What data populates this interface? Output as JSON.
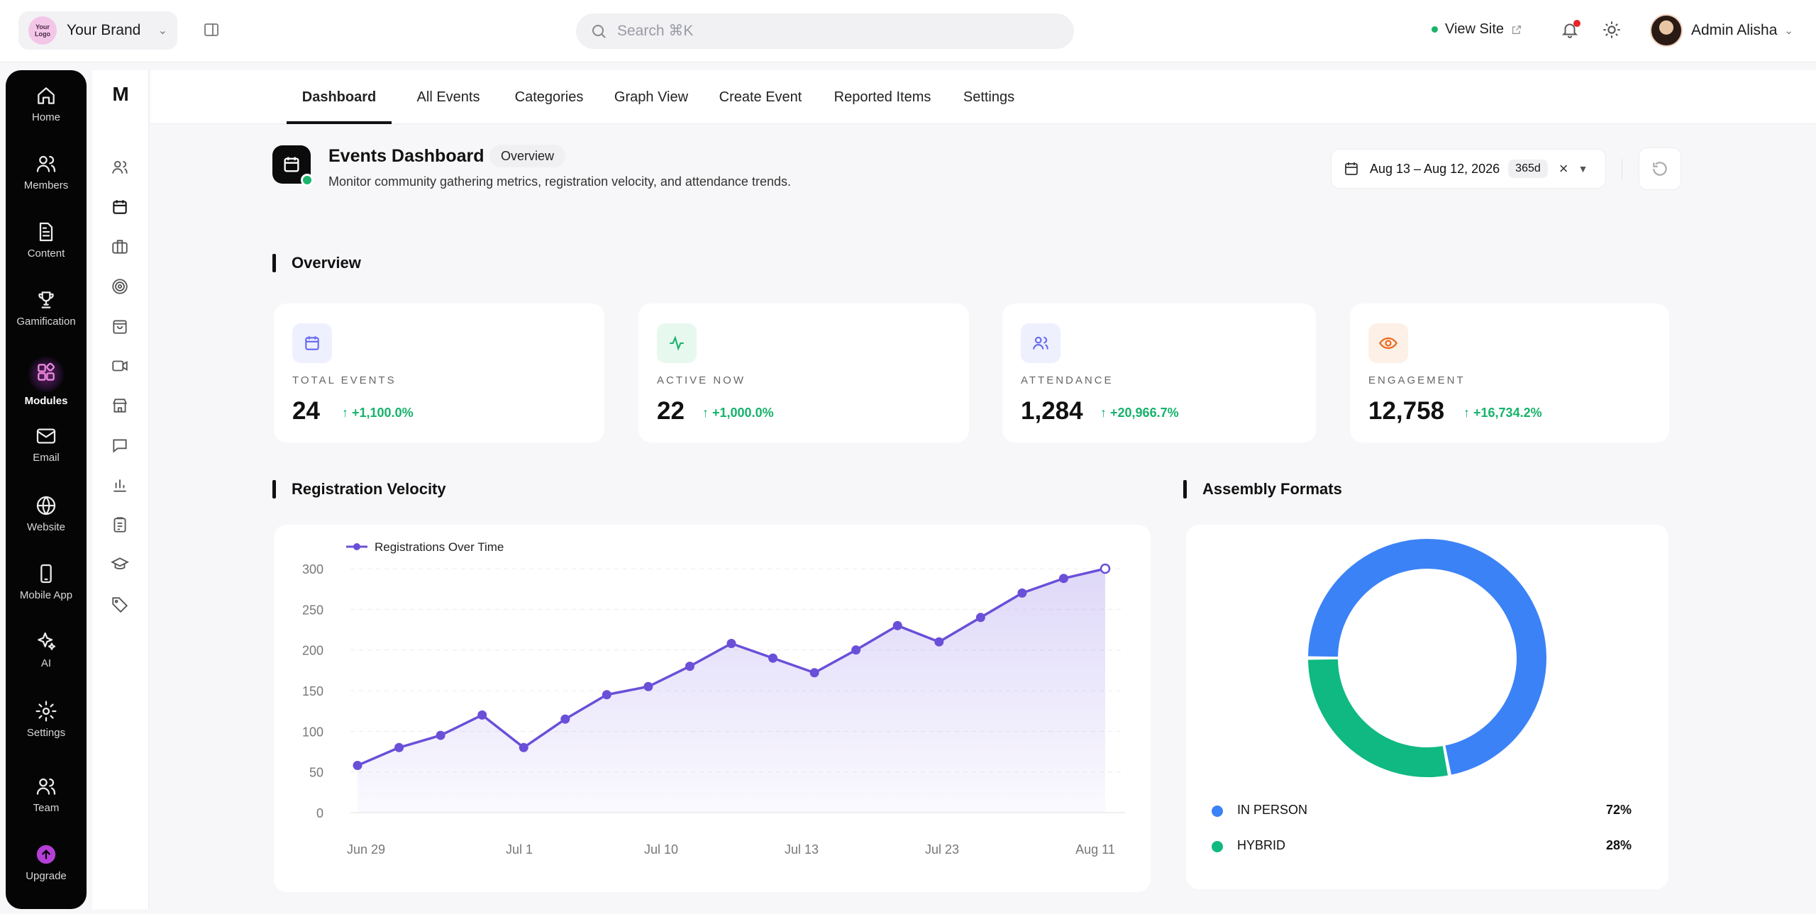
{
  "brand": {
    "logo_text": "Your Logo",
    "name": "Your Brand"
  },
  "search": {
    "placeholder": "Search ⌘K"
  },
  "topbar": {
    "view_site": "View Site",
    "user_name": "Admin Alisha"
  },
  "rail": {
    "items": [
      {
        "label": "Home",
        "icon": "home-icon"
      },
      {
        "label": "Members",
        "icon": "users-icon"
      },
      {
        "label": "Content",
        "icon": "document-icon"
      },
      {
        "label": "Gamification",
        "icon": "trophy-icon"
      },
      {
        "label": "Modules",
        "icon": "modules-icon",
        "active": true
      },
      {
        "label": "Email",
        "icon": "mail-icon"
      },
      {
        "label": "Website",
        "icon": "globe-icon"
      },
      {
        "label": "Mobile App",
        "icon": "phone-icon"
      },
      {
        "label": "AI",
        "icon": "sparkles-icon"
      },
      {
        "label": "Settings",
        "icon": "gear-icon"
      },
      {
        "label": "Team",
        "icon": "team-icon"
      },
      {
        "label": "Upgrade",
        "icon": "upgrade-icon"
      }
    ]
  },
  "subrail": {
    "logo": "M"
  },
  "tabs": [
    "Dashboard",
    "All Events",
    "Categories",
    "Graph View",
    "Create Event",
    "Reported Items",
    "Settings"
  ],
  "header": {
    "title": "Events Dashboard",
    "pill": "Overview",
    "subtitle": "Monitor community gathering metrics, registration velocity, and attendance trends.",
    "date_range": "Aug 13 – Aug 12, 2026",
    "days": "365d"
  },
  "overview": {
    "title": "Overview",
    "cards": [
      {
        "label": "TOTAL EVENTS",
        "value": "24",
        "change": "+1,100.0%",
        "icon": "calendar-icon",
        "color": "#6366f1",
        "bg": "#eef0fe"
      },
      {
        "label": "ACTIVE NOW",
        "value": "22",
        "change": "+1,000.0%",
        "icon": "activity-icon",
        "color": "#15b26b",
        "bg": "#e7f8ef"
      },
      {
        "label": "ATTENDANCE",
        "value": "1,284",
        "change": "+20,966.7%",
        "icon": "users-icon",
        "color": "#6366f1",
        "bg": "#eef0fe"
      },
      {
        "label": "ENGAGEMENT",
        "value": "12,758",
        "change": "+16,734.2%",
        "icon": "eye-icon",
        "color": "#ea6a1e",
        "bg": "#fdf0e6"
      }
    ]
  },
  "velocity": {
    "title": "Registration Velocity"
  },
  "formats": {
    "title": "Assembly Formats"
  },
  "chart_data": [
    {
      "type": "line",
      "title": "",
      "xlabel": "",
      "ylabel": "",
      "ylim": [
        0,
        300
      ],
      "yticks": [
        0,
        50,
        100,
        150,
        200,
        250,
        300
      ],
      "x_tick_labels": [
        "Jun 29",
        "Jul 1",
        "Jul 10",
        "Jul 13",
        "Jul 23",
        "Aug 11"
      ],
      "grid": true,
      "legend": "top-left",
      "series": [
        {
          "name": "Registrations Over Time",
          "color": "#6a4fd8",
          "values": [
            58,
            80,
            95,
            120,
            80,
            115,
            145,
            155,
            180,
            208,
            190,
            172,
            200,
            230,
            210,
            240,
            270,
            288,
            300
          ]
        }
      ]
    },
    {
      "type": "pie",
      "title": "",
      "legend": "bottom",
      "slices": [
        {
          "name": "IN PERSON",
          "value": 72,
          "label": "72%",
          "color": "#3b82f6"
        },
        {
          "name": "HYBRID",
          "value": 28,
          "label": "28%",
          "color": "#10b981"
        }
      ]
    }
  ]
}
